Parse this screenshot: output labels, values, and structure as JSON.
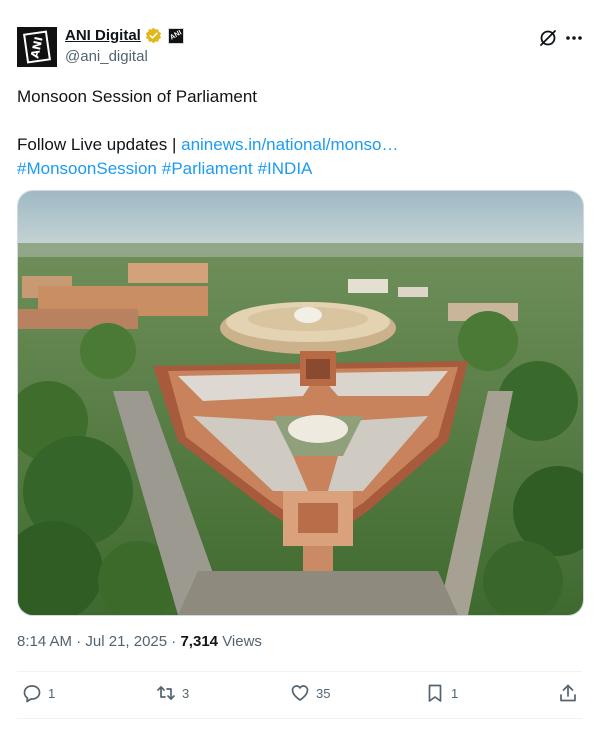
{
  "author": {
    "display_name": "ANI Digital",
    "handle": "@ani_digital",
    "avatar_text": "ANI"
  },
  "tweet": {
    "text_line1": "Monsoon Session of Parliament",
    "text_prefix": "Follow Live updates | ",
    "link_text": "aninews.in/national/monso…",
    "hashtags": [
      "#MonsoonSession",
      "#Parliament",
      "#INDIA"
    ]
  },
  "meta": {
    "time": "8:14 AM",
    "separator": "·",
    "date": "Jul 21, 2025",
    "views_count": "7,314",
    "views_label": "Views"
  },
  "actions": {
    "replies": "1",
    "reposts": "3",
    "likes": "35",
    "bookmarks": "1"
  },
  "colors": {
    "accent": "#1d9bf0",
    "verified_gold": "#e2b719",
    "secondary_text": "#536471"
  },
  "icons": [
    "verified-badge-icon",
    "affiliate-badge-icon",
    "grok-icon",
    "more-icon",
    "reply-icon",
    "repost-icon",
    "like-icon",
    "bookmark-icon",
    "share-icon"
  ]
}
